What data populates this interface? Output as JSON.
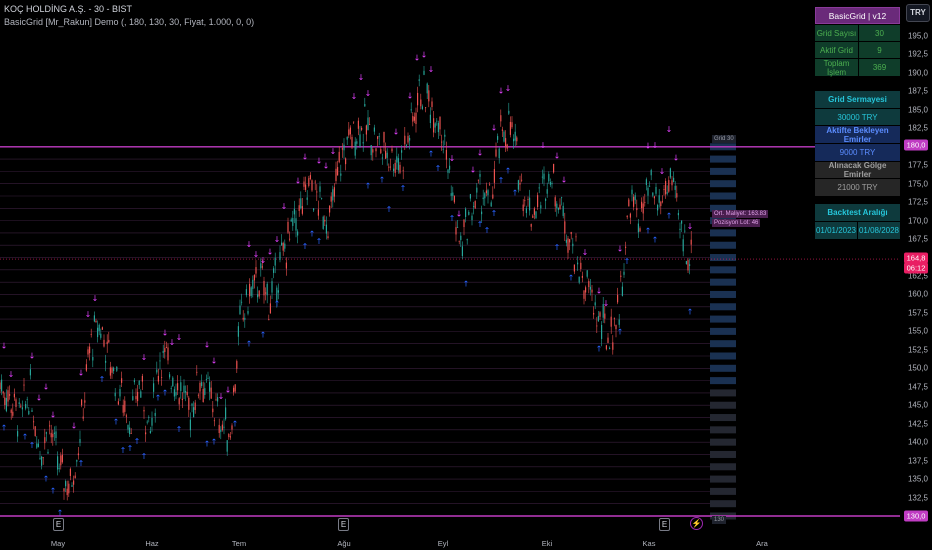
{
  "header": {
    "title": "KOÇ HOLDİNG A.Ş. - 30 - BIST",
    "subtitle": "BasicGrid [Mr_Rakun] Demo (, 180, 130, 30, Fiyat, 1.000, 0, 0)"
  },
  "currency_button": "TRY",
  "colors": {
    "background": "#000000",
    "grid_top_line": "#c03cc3",
    "up_candle": "#26a69a",
    "down_candle": "#ef5350",
    "buy_marker": "#2962ff",
    "sell_marker": "#e040fb",
    "current_price_line": "#e91e63"
  },
  "y_axis": {
    "ticks": [
      "195,0",
      "192,5",
      "190,0",
      "187,5",
      "185,0",
      "182,5",
      "180,0",
      "177,5",
      "175,0",
      "172,5",
      "170,0",
      "167,5",
      "165,0",
      "162,5",
      "160,0",
      "157,5",
      "155,0",
      "152,5",
      "150,0",
      "147,5",
      "145,0",
      "142,5",
      "140,0",
      "137,5",
      "135,0",
      "132,5",
      "130,0"
    ],
    "range": [
      130,
      195
    ],
    "grid_top_tag": "180,0",
    "grid_bottom_tag": "130,0",
    "current_price_tag": "164,8",
    "countdown_tag": "06:12"
  },
  "x_axis": {
    "labels": [
      "May",
      "Haz",
      "Tem",
      "Ağu",
      "Eyl",
      "Eki",
      "Kas",
      "Ara"
    ]
  },
  "earnings_markers": [
    "E",
    "E",
    "E"
  ],
  "dividend_marker": "⚡",
  "chart_overlays": {
    "grid_label_top": "Grid 30",
    "avg_cost_label": "Ort. Maliyet: 163.83",
    "position_label": "Pozisyon Lot: 46",
    "grid_label_bottom": "130"
  },
  "info_table": {
    "header": "BasicGrid | v12",
    "rows": [
      {
        "label": "Grid Sayısı",
        "value": "30"
      },
      {
        "label": "Aktif Grid",
        "value": "9"
      },
      {
        "label": "Toplam İşlem",
        "value": "369"
      }
    ]
  },
  "capital_table": {
    "title": "Grid Sermayesi",
    "value": "30000 TRY",
    "pending_title": "Aktifte Bekleyen Emirler",
    "pending_value": "9000 TRY",
    "shadow_title": "Alınacak Gölge Emirler",
    "shadow_value": "21000 TRY"
  },
  "backtest_table": {
    "title": "Backtest Aralığı",
    "start": "01/01/2023",
    "end": "01/08/2028"
  },
  "chart_data": {
    "type": "candlestick",
    "symbol": "KOÇ HOLDİNG A.Ş. - 30 - BIST",
    "ylim": [
      130,
      195
    ],
    "grid_upper": 180,
    "grid_lower": 130,
    "grid_count": 30,
    "last_price": 164.8,
    "months": [
      "May",
      "Haz",
      "Tem",
      "Ağu",
      "Eyl",
      "Eki",
      "Kas",
      "Ara"
    ],
    "path_points": [
      [
        0,
        148
      ],
      [
        10,
        146
      ],
      [
        20,
        143
      ],
      [
        30,
        147
      ],
      [
        40,
        139
      ],
      [
        50,
        142
      ],
      [
        60,
        136
      ],
      [
        70,
        134
      ],
      [
        80,
        141
      ],
      [
        90,
        153
      ],
      [
        100,
        156
      ],
      [
        110,
        151
      ],
      [
        120,
        147
      ],
      [
        130,
        143
      ],
      [
        140,
        148
      ],
      [
        150,
        141
      ],
      [
        160,
        152
      ],
      [
        170,
        150
      ],
      [
        180,
        147
      ],
      [
        190,
        144
      ],
      [
        200,
        149
      ],
      [
        210,
        146
      ],
      [
        220,
        143
      ],
      [
        230,
        141
      ],
      [
        240,
        156
      ],
      [
        250,
        160
      ],
      [
        260,
        162
      ],
      [
        270,
        159
      ],
      [
        280,
        164
      ],
      [
        290,
        168
      ],
      [
        300,
        171
      ],
      [
        310,
        175
      ],
      [
        320,
        172
      ],
      [
        330,
        170
      ],
      [
        340,
        178
      ],
      [
        350,
        181
      ],
      [
        360,
        183
      ],
      [
        370,
        182
      ],
      [
        380,
        180
      ],
      [
        390,
        179
      ],
      [
        400,
        178
      ],
      [
        410,
        182
      ],
      [
        420,
        188
      ],
      [
        430,
        186
      ],
      [
        440,
        184
      ],
      [
        450,
        176
      ],
      [
        460,
        166
      ],
      [
        470,
        171
      ],
      [
        480,
        174
      ],
      [
        490,
        172
      ],
      [
        500,
        181
      ],
      [
        510,
        183
      ],
      [
        520,
        176
      ],
      [
        530,
        171
      ],
      [
        540,
        173
      ],
      [
        550,
        177
      ],
      [
        560,
        172
      ],
      [
        570,
        168
      ],
      [
        580,
        163
      ],
      [
        590,
        160
      ],
      [
        600,
        156
      ],
      [
        610,
        154
      ],
      [
        620,
        159
      ],
      [
        630,
        173
      ],
      [
        640,
        170
      ],
      [
        650,
        174
      ],
      [
        660,
        172
      ],
      [
        670,
        176
      ],
      [
        680,
        169
      ],
      [
        690,
        165
      ]
    ]
  }
}
